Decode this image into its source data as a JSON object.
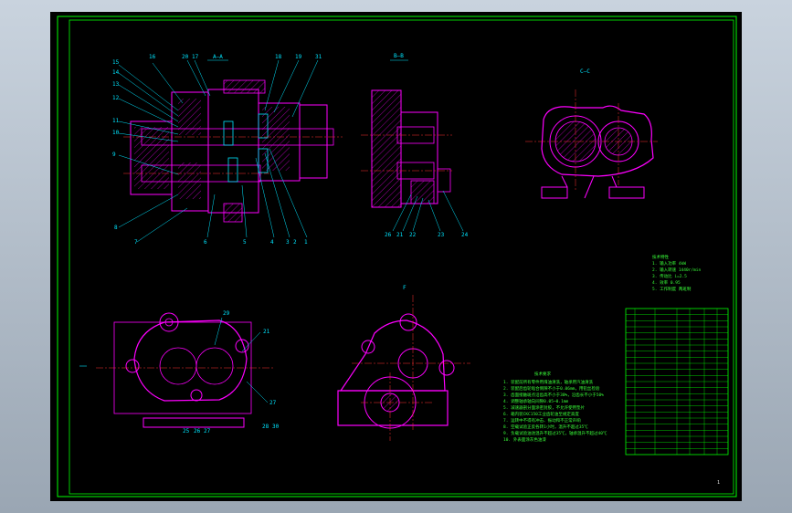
{
  "colors": {
    "background": "#000000",
    "frame": "#00ff00",
    "outline": "#ff00ff",
    "leader": "#00e5ff",
    "hatch": "#ff00ff",
    "center_line": "#ff3030",
    "text": "#39ff39"
  },
  "section_labels": {
    "aa": "A—A",
    "bb": "B—B",
    "cc": "C—C",
    "view": "F"
  },
  "part_numbers_left": [
    "15",
    "14",
    "13",
    "12",
    "11",
    "10",
    "9",
    "8",
    "7"
  ],
  "part_numbers_top": [
    "16",
    "20",
    "17",
    "18",
    "19",
    "31"
  ],
  "part_numbers_bottom": [
    "6",
    "5",
    "4",
    "3",
    "2",
    "1"
  ],
  "part_numbers_bb": [
    "26",
    "21",
    "22",
    "23",
    "24"
  ],
  "part_numbers_front": [
    "29",
    "21",
    "27",
    "28",
    "30",
    "25",
    "26",
    "27"
  ],
  "tech_notes_title": "技术要求",
  "tech_notes": [
    "1. 装配前所有零件用煤油清洗，轴承用汽油清洗",
    "2. 装配后齿轮啮合侧隙不小于0.06mm，用铅丝检验",
    "3. 齿面接触斑点沿齿高不小于30%，沿齿长不小于50%",
    "4. 调整轴承轴向间隙0.05~0.1mm",
    "5. 减速器剖分面涂密封胶，不允许使用垫片",
    "6. 箱内装CKC150工业齿轮油至规定高度",
    "7. 运转中不得有冲击、振动和不正常声响",
    "8. 空载试验正反各转1小时，温升不超过35℃",
    "9. 负载试验油池温升不超过35℃，轴承温升不超过40℃",
    "10. 外表面涂灰色油漆"
  ],
  "spec_title": "技术特性",
  "spec_lines": [
    "1. 输入功率 4kW",
    "2. 输入转速 1440r/min",
    "3. 传动比 i=2.5",
    "4. 效率 0.95",
    "5. 工作制度 两班制"
  ],
  "page_number": "1"
}
